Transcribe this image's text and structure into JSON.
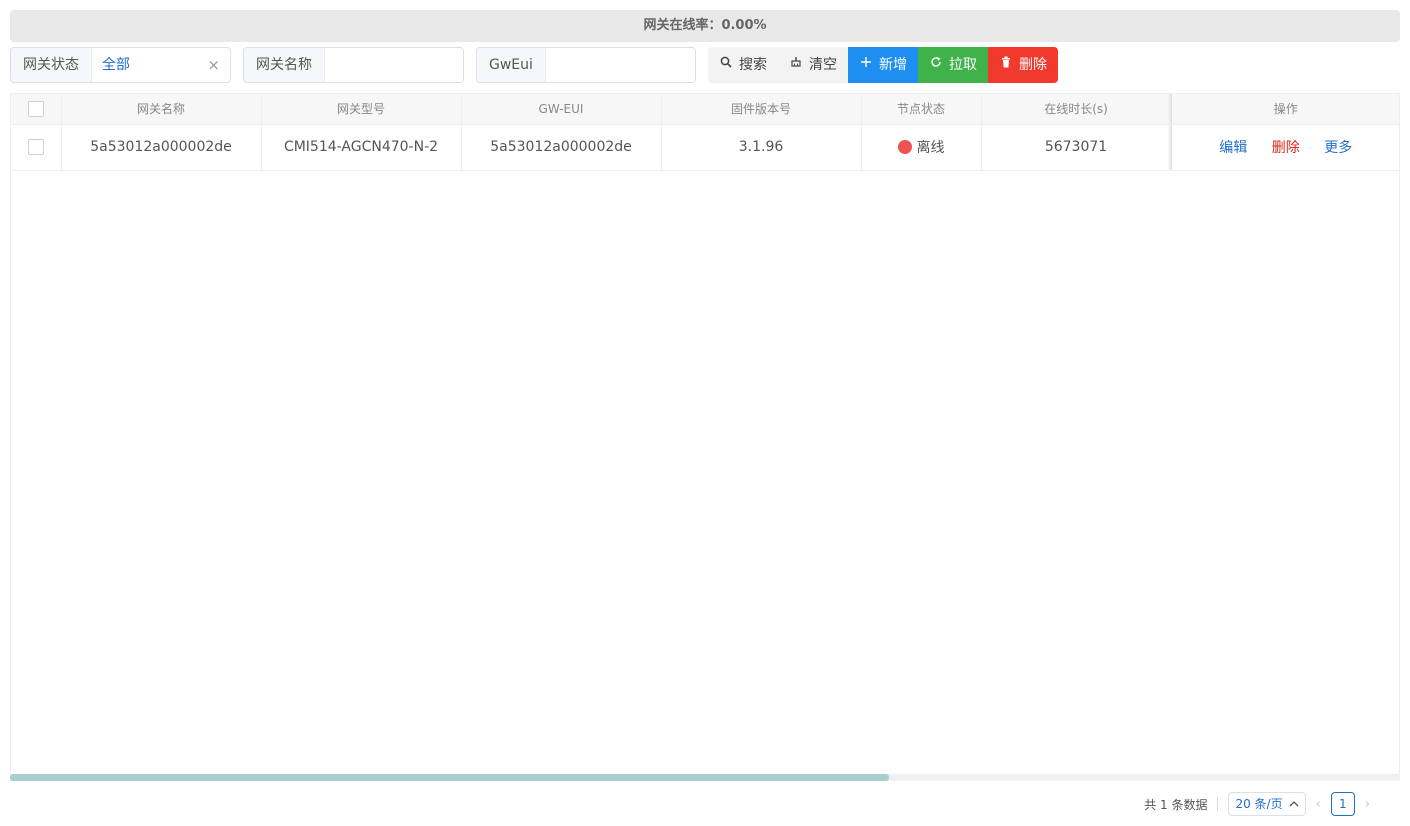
{
  "banner": {
    "text": "网关在线率：0.00%"
  },
  "filters": {
    "status": {
      "label": "网关状态",
      "value": "全部",
      "clear": "×"
    },
    "name": {
      "label": "网关名称",
      "value": "",
      "placeholder": ""
    },
    "gweui": {
      "label": "GwEui",
      "value": "",
      "placeholder": ""
    }
  },
  "buttons": {
    "search": "搜索",
    "clear": "清空",
    "add": "新增",
    "pull": "拉取",
    "delete": "删除"
  },
  "icons": {
    "search": "search-icon",
    "clear": "broom-icon",
    "add": "plus-icon",
    "pull": "refresh-icon",
    "delete": "trash-icon"
  },
  "table": {
    "columns": [
      "网关名称",
      "网关型号",
      "GW-EUI",
      "固件版本号",
      "节点状态",
      "在线时长(s)",
      "操作"
    ],
    "rows": [
      {
        "name": "5a53012a000002de",
        "model": "CMI514-AGCN470-N-2",
        "eui": "5a53012a000002de",
        "firmware": "3.1.96",
        "status": "离线",
        "status_color": "#ee5253",
        "uptime": "5673071",
        "actions": {
          "edit": "编辑",
          "delete": "删除",
          "more": "更多"
        }
      }
    ]
  },
  "pagination": {
    "total": "共 1 条数据",
    "page_size": "20 条/页",
    "prev": "‹",
    "next": "›",
    "current_page": "1"
  },
  "colors": {
    "primary": "#1f8ef1",
    "success": "#3fb24c",
    "danger": "#f2392d",
    "link": "#1e6fc9"
  }
}
